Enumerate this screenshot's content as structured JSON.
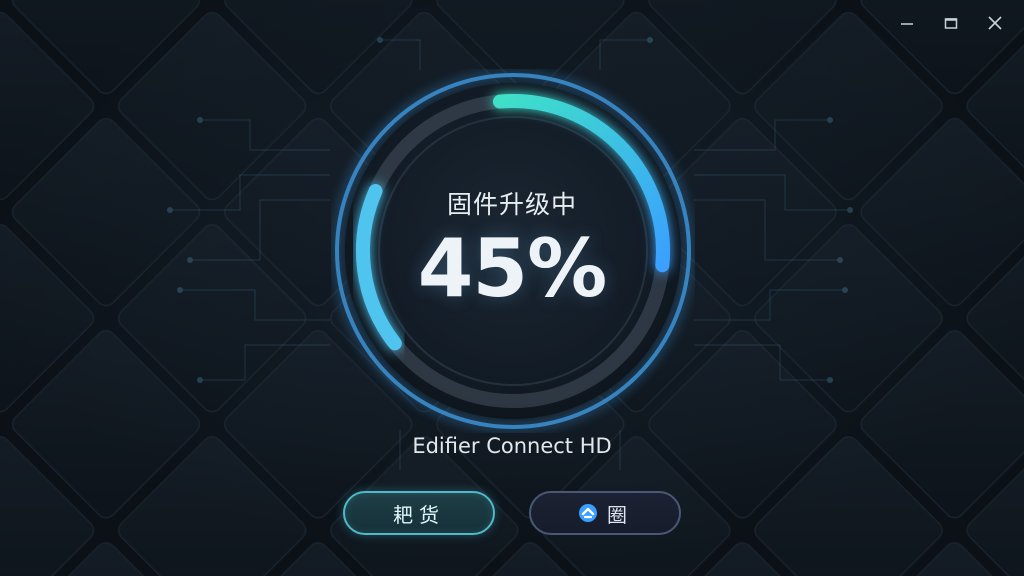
{
  "window": {
    "minimize_icon": "minimize-icon",
    "maximize_icon": "maximize-icon",
    "close_icon": "close-icon"
  },
  "progress": {
    "status": "固件升级中",
    "percent_text": "45%",
    "value": 0.45
  },
  "device": {
    "name": "Edifier Connect HD"
  },
  "buttons": {
    "primary_label": "耙货",
    "secondary_label": "圈",
    "secondary_icon": "refresh-icon"
  },
  "colors": {
    "accent": "#4fb8c9",
    "ring_start": "#3fe0c8",
    "ring_end": "#3aa0ff"
  }
}
